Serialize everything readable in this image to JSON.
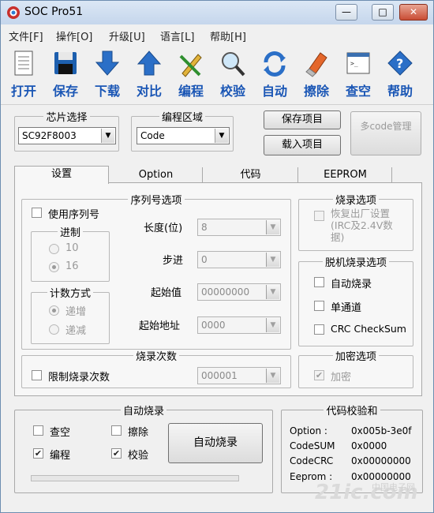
{
  "window": {
    "title": "SOC Pro51",
    "controls": {
      "minimize": "—",
      "maximize": "□",
      "close": "✕"
    }
  },
  "menu": [
    "文件[F]",
    "操作[O]",
    "升级[U]",
    "语言[L]",
    "帮助[H]"
  ],
  "toolbar": [
    {
      "label": "打开",
      "icon": "open-file-icon"
    },
    {
      "label": "保存",
      "icon": "save-disk-icon"
    },
    {
      "label": "下载",
      "icon": "download-arrow-icon"
    },
    {
      "label": "对比",
      "icon": "compare-arrow-icon"
    },
    {
      "label": "编程",
      "icon": "program-pencil-icon"
    },
    {
      "label": "校验",
      "icon": "verify-magnifier-icon"
    },
    {
      "label": "自动",
      "icon": "auto-refresh-icon"
    },
    {
      "label": "擦除",
      "icon": "erase-eraser-icon"
    },
    {
      "label": "查空",
      "icon": "blank-check-icon"
    },
    {
      "label": "帮助",
      "icon": "help-question-icon"
    }
  ],
  "chip_select": {
    "title": "芯片选择",
    "value": "SC92F8003"
  },
  "program_area": {
    "title": "编程区域",
    "value": "Code"
  },
  "buttons": {
    "save_project": "保存项目",
    "load_project": "载入项目",
    "multi_code": "多code管理"
  },
  "tabs": [
    "设置",
    "Option",
    "代码",
    "EEPROM"
  ],
  "serial": {
    "title": "序列号选项",
    "use_serial": "使用序列号",
    "base_title": "进制",
    "base_10": "10",
    "base_16": "16",
    "count_title": "计数方式",
    "inc": "递增",
    "dec": "递减",
    "length_label": "长度(位)",
    "length_value": "8",
    "step_label": "步进",
    "step_value": "0",
    "start_label": "起始值",
    "start_value": "00000000",
    "addr_label": "起始地址",
    "addr_value": "0000"
  },
  "burn_count": {
    "title": "烧录次数",
    "limit": "限制烧录次数",
    "value": "000001"
  },
  "burn_options": {
    "title": "烧录选项",
    "restore": "恢复出厂设置(IRC及2.4V数据)"
  },
  "offline": {
    "title": "脱机烧录选项",
    "auto_burn": "自动烧录",
    "single_channel": "单通道",
    "crc": "CRC CheckSum"
  },
  "encrypt": {
    "title": "加密选项",
    "encrypt": "加密"
  },
  "auto_burn": {
    "title": "自动烧录",
    "blank": "查空",
    "erase": "擦除",
    "program": "编程",
    "verify": "校验",
    "program_checked": true,
    "verify_checked": true,
    "button": "自动烧录"
  },
  "checksum": {
    "title": "代码校验和",
    "rows": [
      {
        "key": "Option :",
        "value": "0x005b-3e0f"
      },
      {
        "key": "CodeSUM",
        "value": "0x0000"
      },
      {
        "key": "CodeCRC",
        "value": "0x00000000"
      },
      {
        "key": "Eeprom :",
        "value": "0x00000000"
      }
    ]
  },
  "watermark": "21ic.com",
  "watermark_sub": "中国电子网"
}
